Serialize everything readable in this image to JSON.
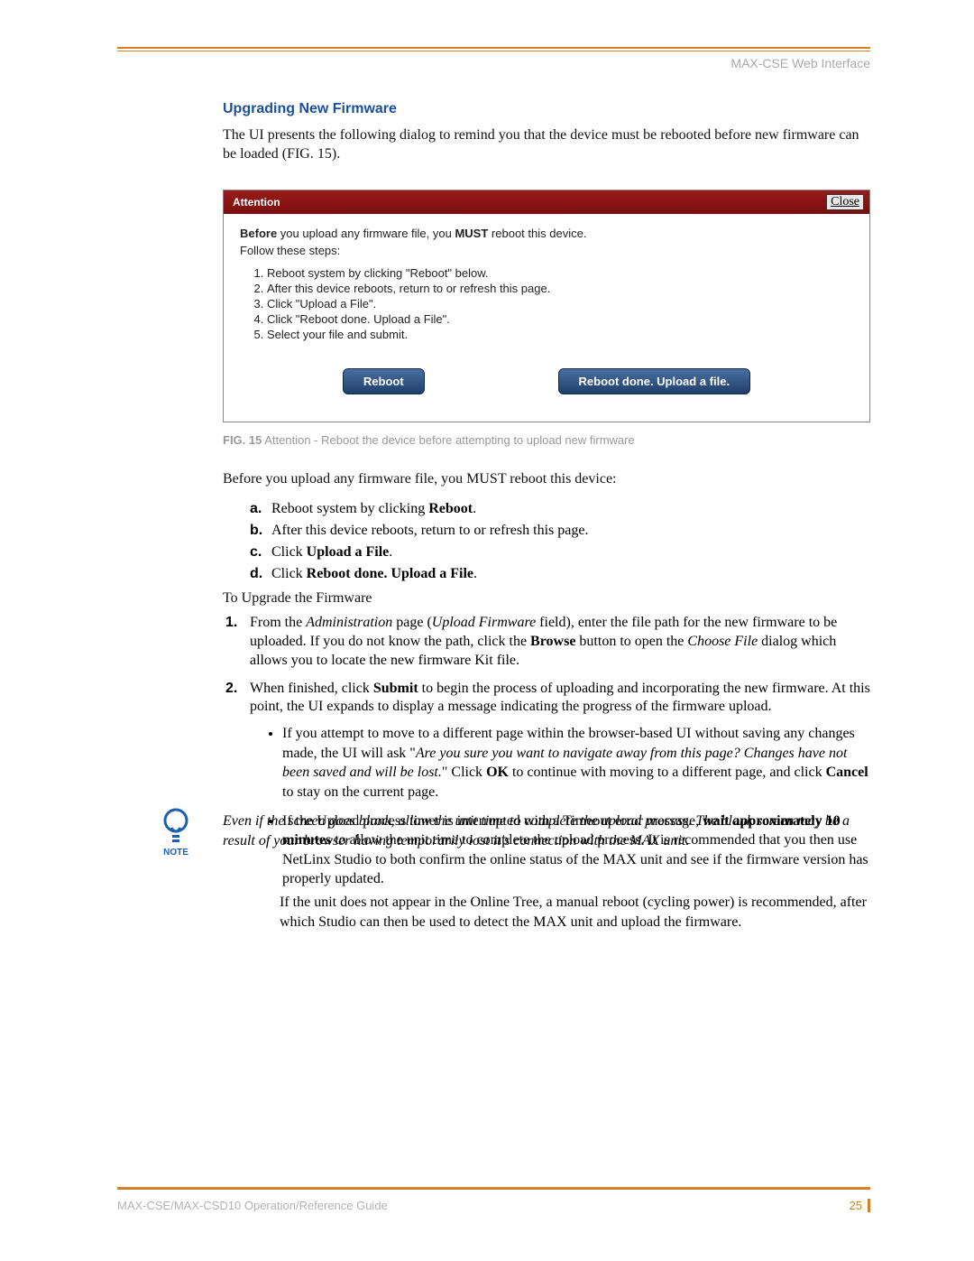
{
  "header": {
    "running": "MAX-CSE Web Interface"
  },
  "section": {
    "title": "Upgrading New Firmware",
    "intro": "The UI presents the following dialog to remind you that the device must be rebooted before new firmware can be loaded (FIG. 15)."
  },
  "dialog": {
    "title": "Attention",
    "close": "Close",
    "before_bold": "Before",
    "before_rest": " you upload any firmware file, you ",
    "must": "MUST",
    "before_tail": " reboot this device.",
    "follow": "Follow these steps:",
    "steps": [
      "Reboot system by clicking \"Reboot\" below.",
      "After this device reboots, return to or refresh this page.",
      "Click \"Upload a File\".",
      "Click \"Reboot done. Upload a File\".",
      "Select your file and submit."
    ],
    "btn_reboot": "Reboot",
    "btn_reboot_done": "Reboot done. Upload a file."
  },
  "figcap": {
    "label": "FIG. 15",
    "text": "  Attention - Reboot the device before attempting to upload new firmware"
  },
  "pre_letter": "Before you upload any firmware file, you MUST reboot this device:",
  "letters": {
    "a": {
      "m": "a.",
      "pre": "Reboot system by clicking ",
      "b": "Reboot",
      "post": "."
    },
    "b": {
      "m": "b.",
      "text": "After this device reboots, return to or refresh this page."
    },
    "c": {
      "m": "c.",
      "pre": "Click ",
      "b": "Upload a File",
      "post": "."
    },
    "d": {
      "m": "d.",
      "pre": "Click ",
      "b": "Reboot done. Upload a File",
      "post": "."
    }
  },
  "to_upgrade": "To Upgrade the Firmware",
  "nums": {
    "1": {
      "m": "1.",
      "a": "From the ",
      "i1": "Administration",
      "b": " page (",
      "i2": "Upload Firmware",
      "c": " field), enter the file path for the new firmware to be uploaded. If you do not know the path, click the ",
      "bold1": "Browse",
      "d": " button to open the ",
      "i3": "Choose File",
      "e": " dialog which allows you to locate the new firmware Kit file."
    },
    "2": {
      "m": "2.",
      "a": "When finished, click ",
      "bold1": "Submit",
      "b": " to begin the process of uploading and incorporating the new firmware. At this point, the UI expands to display a message indicating the progress of the firmware upload."
    }
  },
  "bullets": {
    "0": {
      "a": "If you attempt to move to a different page within the browser-based UI without saving any changes made, the UI will ask \"",
      "i": "Are you sure you want to navigate away from this page? Changes have not been saved and will be lost.",
      "b": "\" Click ",
      "bold1": "OK",
      "c": " to continue with moving to a different page, and click ",
      "bold2": "Cancel",
      "d": " to stay on the current page."
    },
    "1": {
      "a": "If the Upload process timer is interrupted with a Timeout error message, ",
      "bold1": "wait approximately 10 minutes",
      "b": " to allow the unit time to complete the upload process. It is recommended that you then use NetLinx Studio to both confirm the online status of the MAX unit and see if the firmware version has properly updated."
    }
  },
  "note": {
    "label": "NOTE",
    "text": "Even if the screen goes blank, allow the unit time to complete the upload process. The blank screen may be a result of your browser having temporarily lost it's connection with the MAX unit."
  },
  "after_note": "If the unit does not appear in the Online Tree, a manual reboot (cycling power) is recommended, after which Studio can then be used to detect the MAX unit and upload the firmware.",
  "footer": {
    "left": "MAX-CSE/MAX-CSD10 Operation/Reference Guide",
    "page": "25"
  }
}
